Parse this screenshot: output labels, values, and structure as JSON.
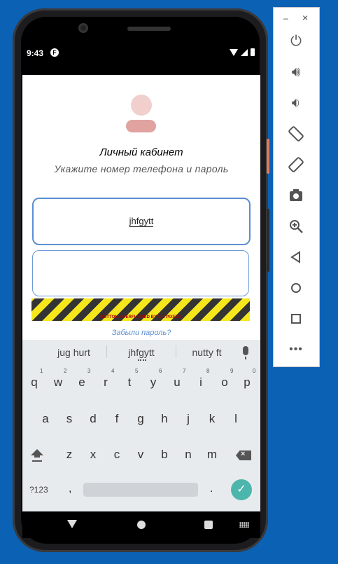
{
  "status_bar": {
    "time": "9:43",
    "app_indicator": "F"
  },
  "login": {
    "title": "Личный кабинет",
    "subtitle": "Укажите номер телефона и пароль",
    "phone_value": "jhfgytt",
    "password_value": "",
    "overflow_warning": "BOTTOM OVERFLOWED BY 131 PIXELS",
    "forgot_password": "Забыли пароль?"
  },
  "keyboard": {
    "suggestions": [
      "jug hurt",
      "jhfgytt",
      "nutty ft"
    ],
    "row1": [
      "q",
      "w",
      "e",
      "r",
      "t",
      "y",
      "u",
      "i",
      "o",
      "p"
    ],
    "row1_numbers": [
      "1",
      "2",
      "3",
      "4",
      "5",
      "6",
      "7",
      "8",
      "9",
      "0"
    ],
    "row2": [
      "a",
      "s",
      "d",
      "f",
      "g",
      "h",
      "j",
      "k",
      "l"
    ],
    "row3": [
      "z",
      "x",
      "c",
      "v",
      "b",
      "n",
      "m"
    ],
    "symbols_key": "?123",
    "comma": ",",
    "period": "."
  },
  "toolbar": {
    "minimize": "–",
    "close": "×",
    "icons": [
      "power-icon",
      "volume-up-icon",
      "volume-down-icon",
      "rotate-left-icon",
      "rotate-right-icon",
      "camera-icon",
      "zoom-icon",
      "back-icon",
      "home-icon",
      "overview-icon",
      "more-icon"
    ]
  }
}
